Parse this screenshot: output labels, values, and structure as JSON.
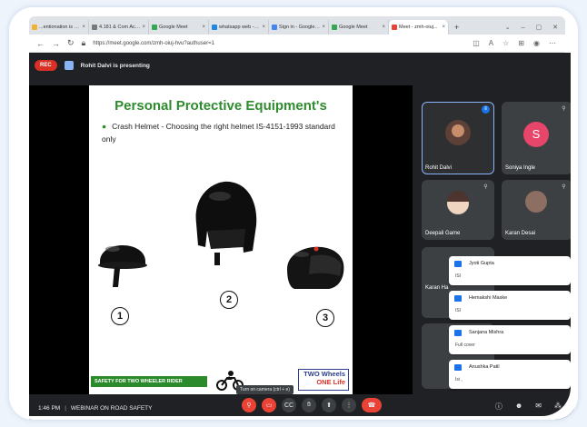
{
  "browser": {
    "tabs": [
      {
        "title": "...entionation is Rea...",
        "color": "#f2b134"
      },
      {
        "title": "4.181 & Com Account...",
        "color": "#7a7a7a"
      },
      {
        "title": "Google Meet",
        "color": "#34a853"
      },
      {
        "title": "whatsapp web - Bing",
        "color": "#1e88e5"
      },
      {
        "title": "Sign in - Google Acco...",
        "color": "#4285f4"
      },
      {
        "title": "Google Meet",
        "color": "#34a853"
      },
      {
        "title": "Meet - zmh-oiuj...",
        "color": "#ea4335"
      }
    ],
    "new_tab": "+",
    "url": "https://meet.google.com/zmh-oiuj-hvu?authuser=1"
  },
  "meet": {
    "rec_label": "REC",
    "presenter_text": "Rohit Dalvi is presenting",
    "time": "1:46 PM",
    "separator": "|",
    "meeting_name": "WEBINAR ON ROAD SAFETY",
    "camera_tooltip": "Turn on camera (ctrl + e)"
  },
  "slide": {
    "title": "Personal Protective Equipment's",
    "bullet": "Crash Helmet  - Choosing the right helmet IS-4151-1993 standard only",
    "labels": [
      "1",
      "2",
      "3"
    ],
    "banner_left": "SAFETY FOR TWO WHEELER RIDER",
    "banner_right_1": "TWO Wheels",
    "banner_right_2": "ONE Life"
  },
  "participants": [
    {
      "name": "Rohit Dalvi",
      "initial": "",
      "avatar_color": "#5d4037",
      "speaking": true
    },
    {
      "name": "Soniya Ingle",
      "initial": "S",
      "avatar_color": "#e8456b",
      "speaking": false
    },
    {
      "name": "Deepali Game",
      "initial": "",
      "avatar_color": "#a1887f",
      "speaking": false
    },
    {
      "name": "Karan Desai",
      "initial": "",
      "avatar_color": "#8d6e63",
      "speaking": false
    },
    {
      "name": "Karan Ha",
      "initial": "",
      "avatar_color": "#5f6368",
      "speaking": false
    }
  ],
  "chat": [
    {
      "author": "Jyoti Gupta",
      "text": "ISI"
    },
    {
      "author": "Hemakshi Maske",
      "text": "ISI"
    },
    {
      "author": "Sanjana Mishra",
      "text": "Full cover"
    },
    {
      "author": "Anushka Patil",
      "text": "Isi ,"
    }
  ]
}
